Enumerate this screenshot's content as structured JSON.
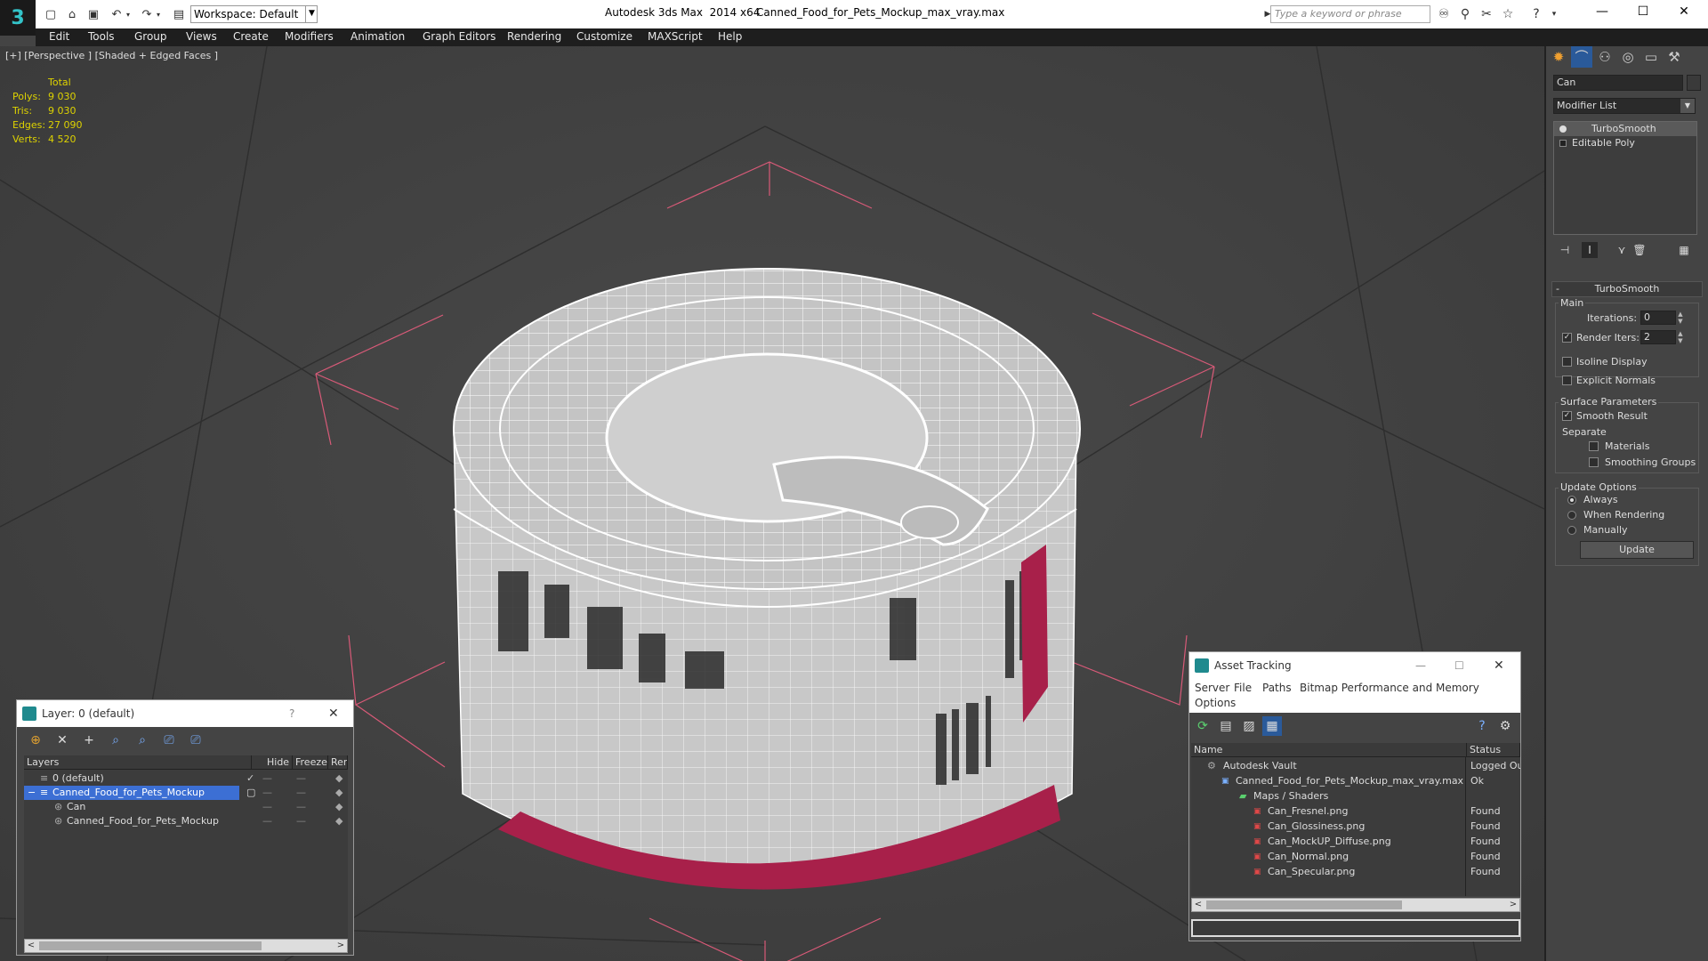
{
  "titlebar": {
    "app_title": "Autodesk 3ds Max  2014 x64",
    "file_title": "Canned_Food_for_Pets_Mockup_max_vray.max",
    "workspace": "Workspace: Default",
    "search_placeholder": "Type a keyword or phrase"
  },
  "menubar": [
    "Edit",
    "Tools",
    "Group",
    "Views",
    "Create",
    "Modifiers",
    "Animation",
    "Graph Editors",
    "Rendering",
    "Customize",
    "MAXScript",
    "Help"
  ],
  "viewport": {
    "label": "[+] [Perspective ] [Shaded + Edged Faces ]",
    "stats_header": "Total",
    "stats": [
      {
        "label": "Polys:",
        "value": "9 030"
      },
      {
        "label": "Tris:",
        "value": "9 030"
      },
      {
        "label": "Edges:",
        "value": "27 090"
      },
      {
        "label": "Verts:",
        "value": "4 520"
      }
    ]
  },
  "command_panel": {
    "object_name": "Can",
    "modifier_list": "Modifier List",
    "stack": [
      "TurboSmooth",
      "Editable Poly"
    ],
    "rollout_title": "TurboSmooth",
    "main_label": "Main",
    "iterations_label": "Iterations:",
    "iterations_value": "0",
    "render_iters_label": "Render Iters:",
    "render_iters_value": "2",
    "render_iters_checked": true,
    "isoline_label": "Isoline Display",
    "explicit_normals_label": "Explicit Normals",
    "surface_params_label": "Surface Parameters",
    "smooth_result_label": "Smooth Result",
    "smooth_result_checked": true,
    "separate_label": "Separate",
    "materials_label": "Materials",
    "smoothing_groups_label": "Smoothing Groups",
    "update_options_label": "Update Options",
    "always_label": "Always",
    "when_rendering_label": "When Rendering",
    "manually_label": "Manually",
    "update_button": "Update"
  },
  "layer_panel": {
    "title": "Layer: 0 (default)",
    "help": "?",
    "columns": [
      "Layers",
      "Hide",
      "Freeze",
      "Rend"
    ],
    "rows": [
      {
        "name": "0 (default)",
        "indent": 1,
        "selected": false
      },
      {
        "name": "Canned_Food_for_Pets_Mockup",
        "indent": 1,
        "selected": true
      },
      {
        "name": "Can",
        "indent": 2,
        "selected": false
      },
      {
        "name": "Canned_Food_for_Pets_Mockup",
        "indent": 2,
        "selected": false
      }
    ]
  },
  "asset_tracking": {
    "title": "Asset Tracking",
    "menu": [
      "Server",
      "File",
      "Paths",
      "Bitmap Performance and Memory",
      "Options"
    ],
    "columns": [
      "Name",
      "Status"
    ],
    "rows": [
      {
        "name": "Autodesk Vault",
        "status": "Logged Ou",
        "indent": 1,
        "icon": "vault"
      },
      {
        "name": "Canned_Food_for_Pets_Mockup_max_vray.max",
        "status": "Ok",
        "indent": 2,
        "icon": "max"
      },
      {
        "name": "Maps / Shaders",
        "status": "",
        "indent": 3,
        "icon": "folder"
      },
      {
        "name": "Can_Fresnel.png",
        "status": "Found",
        "indent": 4,
        "icon": "png"
      },
      {
        "name": "Can_Glossiness.png",
        "status": "Found",
        "indent": 4,
        "icon": "png"
      },
      {
        "name": "Can_MockUP_Diffuse.png",
        "status": "Found",
        "indent": 4,
        "icon": "png"
      },
      {
        "name": "Can_Normal.png",
        "status": "Found",
        "indent": 4,
        "icon": "png"
      },
      {
        "name": "Can_Specular.png",
        "status": "Found",
        "indent": 4,
        "icon": "png"
      }
    ]
  },
  "colors": {
    "accent_teal": "#1f8a8e",
    "selection_blue": "#3c6fd4",
    "stats_yellow": "#ddd200",
    "label_red": "#a8204a",
    "bbox_pink": "#e0607a"
  }
}
